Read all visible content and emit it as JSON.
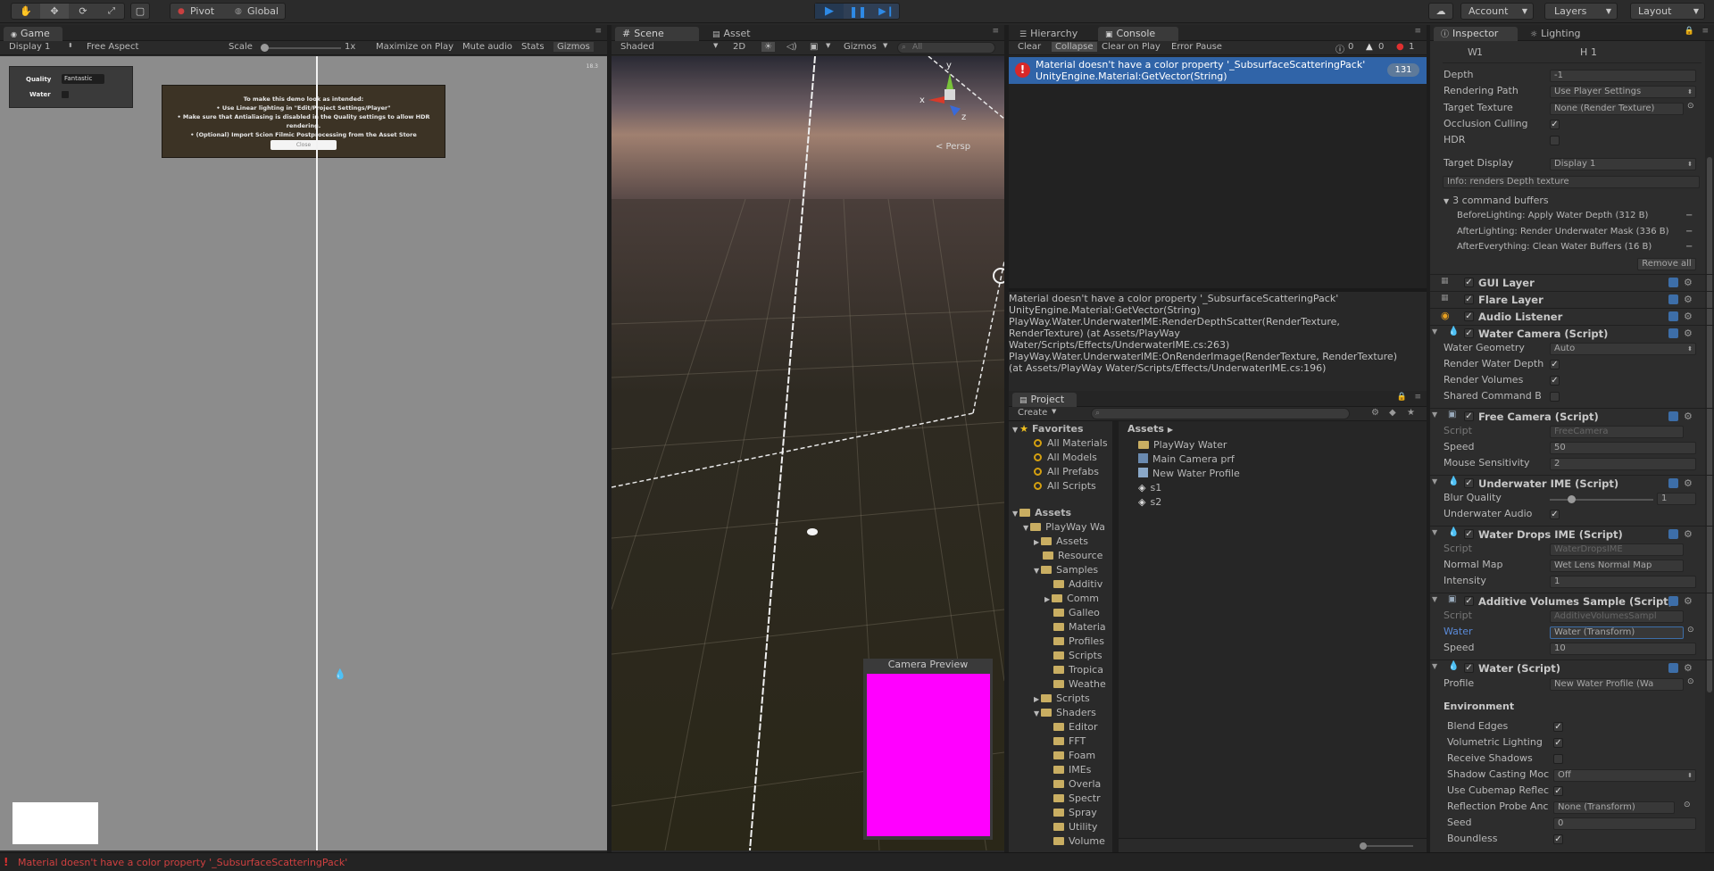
{
  "toolbar": {
    "pivot": "Pivot",
    "global": "Global",
    "account": "Account",
    "layers": "Layers",
    "layout": "Layout"
  },
  "game": {
    "tab": "Game",
    "display": "Display 1",
    "aspect": "Free Aspect",
    "scale_label": "Scale",
    "scale_value": "1x",
    "maximize": "Maximize on Play",
    "mute": "Mute audio",
    "stats": "Stats",
    "gizmos": "Gizmos",
    "fps": "18.3",
    "quality_label": "Quality",
    "quality_value": "Fantastic",
    "water_label": "Water",
    "notice_title": "To make this demo look as intended:",
    "notice_line1": "• Use Linear lighting in \"Edit/Project Settings/Player\"",
    "notice_line2": "• Make sure that Antialiasing is disabled in the Quality settings to allow HDR rendering.",
    "notice_line3": "• (Optional) Import Scion Filmic Postprocessing from the Asset Store",
    "notice_close": "Close"
  },
  "scene": {
    "tab": "Scene",
    "tab2": "Asset Store",
    "shaded": "Shaded",
    "mode2d": "2D",
    "gizmos": "Gizmos",
    "search": "All",
    "persp": "< Persp",
    "axis_y": "y",
    "axis_x": "x",
    "axis_z": "z",
    "camera_preview": "Camera Preview"
  },
  "hierarchy": {
    "tab": "Hierarchy"
  },
  "console": {
    "tab": "Console",
    "clear": "Clear",
    "collapse": "Collapse",
    "clear_on_play": "Clear on Play",
    "error_pause": "Error Pause",
    "count_info": "0",
    "count_warn": "0",
    "count_err": "1",
    "entry_line1": "Material doesn't have a color property '_SubsurfaceScatteringPack'",
    "entry_line2": "UnityEngine.Material:GetVector(String)",
    "entry_count": "131",
    "detail": [
      "Material doesn't have a color property '_SubsurfaceScatteringPack'",
      "UnityEngine.Material:GetVector(String)",
      "PlayWay.Water.UnderwaterIME:RenderDepthScatter(RenderTexture,",
      "RenderTexture) (at Assets/PlayWay",
      "Water/Scripts/Effects/UnderwaterIME.cs:263)",
      "PlayWay.Water.UnderwaterIME:OnRenderImage(RenderTexture, RenderTexture)",
      "(at Assets/PlayWay Water/Scripts/Effects/UnderwaterIME.cs:196)"
    ]
  },
  "project": {
    "tab": "Project",
    "create": "Create",
    "favorites": "Favorites",
    "fav_items": [
      "All Materials",
      "All Models",
      "All Prefabs",
      "All Scripts"
    ],
    "assets_root": "Assets",
    "tree": [
      "PlayWay Wa",
      "Assets",
      "Resource",
      "Samples",
      "Additiv",
      "Comm",
      "Galleo",
      "Materia",
      "Profiles",
      "Scripts",
      "Tropica",
      "Weathe",
      "Scripts",
      "Shaders",
      "Editor",
      "FFT",
      "Foam",
      "IMEs",
      "Overla",
      "Spectr",
      "Spray",
      "Utility",
      "Volume"
    ],
    "breadcrumb": "Assets",
    "files": [
      "PlayWay Water",
      "Main Camera prf",
      "New Water Profile",
      "s1",
      "s2"
    ]
  },
  "inspector": {
    "tab": "Inspector",
    "tab2": "Lighting",
    "w_label": "W",
    "w_value": "1",
    "h_label": "H",
    "h_value": "1",
    "depth_label": "Depth",
    "depth_value": "-1",
    "rendering_label": "Rendering Path",
    "rendering_value": "Use Player Settings",
    "target_tex_label": "Target Texture",
    "target_tex_value": "None (Render Texture)",
    "occlusion_label": "Occlusion Culling",
    "hdr_label": "HDR",
    "target_display_label": "Target Display",
    "target_display_value": "Display 1",
    "info": "Info: renders Depth texture",
    "cmd_buffers": "3 command buffers",
    "cmd1": "BeforeLighting: Apply Water Depth (312 B)",
    "cmd2": "AfterLighting: Render Underwater Mask (336 B)",
    "cmd3": "AfterEverything: Clean Water Buffers (16 B)",
    "remove_all": "Remove all",
    "gui_layer": "GUI Layer",
    "flare_layer": "Flare Layer",
    "audio_listener": "Audio Listener",
    "water_camera": "Water Camera (Script)",
    "water_geometry_label": "Water Geometry",
    "water_geometry_value": "Auto",
    "render_water_depth": "Render Water Depth",
    "render_volumes": "Render Volumes",
    "shared_cmd": "Shared Command B",
    "free_camera": "Free Camera (Script)",
    "script_label": "Script",
    "free_camera_script": "FreeCamera",
    "speed_label": "Speed",
    "speed_value": "50",
    "mouse_sens_label": "Mouse Sensitivity",
    "mouse_sens_value": "2",
    "underwater_ime": "Underwater IME (Script)",
    "blur_label": "Blur Quality",
    "blur_value": "1",
    "underwater_audio": "Underwater Audio",
    "water_drops": "Water Drops IME (Script)",
    "water_drops_script": "WaterDropsIME",
    "normal_map_label": "Normal Map",
    "normal_map_value": "Wet Lens Normal Map",
    "intensity_label": "Intensity",
    "intensity_value": "1",
    "additive": "Additive Volumes Sample (Script)",
    "additive_script": "AdditiveVolumesSampl",
    "water_field_label": "Water",
    "water_field_value": "Water (Transform)",
    "speed2_value": "10",
    "water_script": "Water (Script)",
    "profile_label": "Profile",
    "profile_value": "New Water Profile (Wa",
    "environment": "Environment",
    "blend_edges": "Blend Edges",
    "volumetric": "Volumetric Lighting",
    "receive_shadows": "Receive Shadows",
    "shadow_casting_label": "Shadow Casting Moc",
    "shadow_casting_value": "Off",
    "use_cubemap": "Use Cubemap Reflec",
    "reflection_probe_label": "Reflection Probe Anc",
    "reflection_probe_value": "None (Transform)",
    "seed_label": "Seed",
    "seed_value": "0",
    "boundless": "Boundless"
  },
  "status": {
    "message": "Material doesn't have a color property '_SubsurfaceScatteringPack'"
  },
  "colors": {
    "error": "#e03030",
    "accent": "#3d6ea8",
    "magenta": "#ff00ff"
  }
}
